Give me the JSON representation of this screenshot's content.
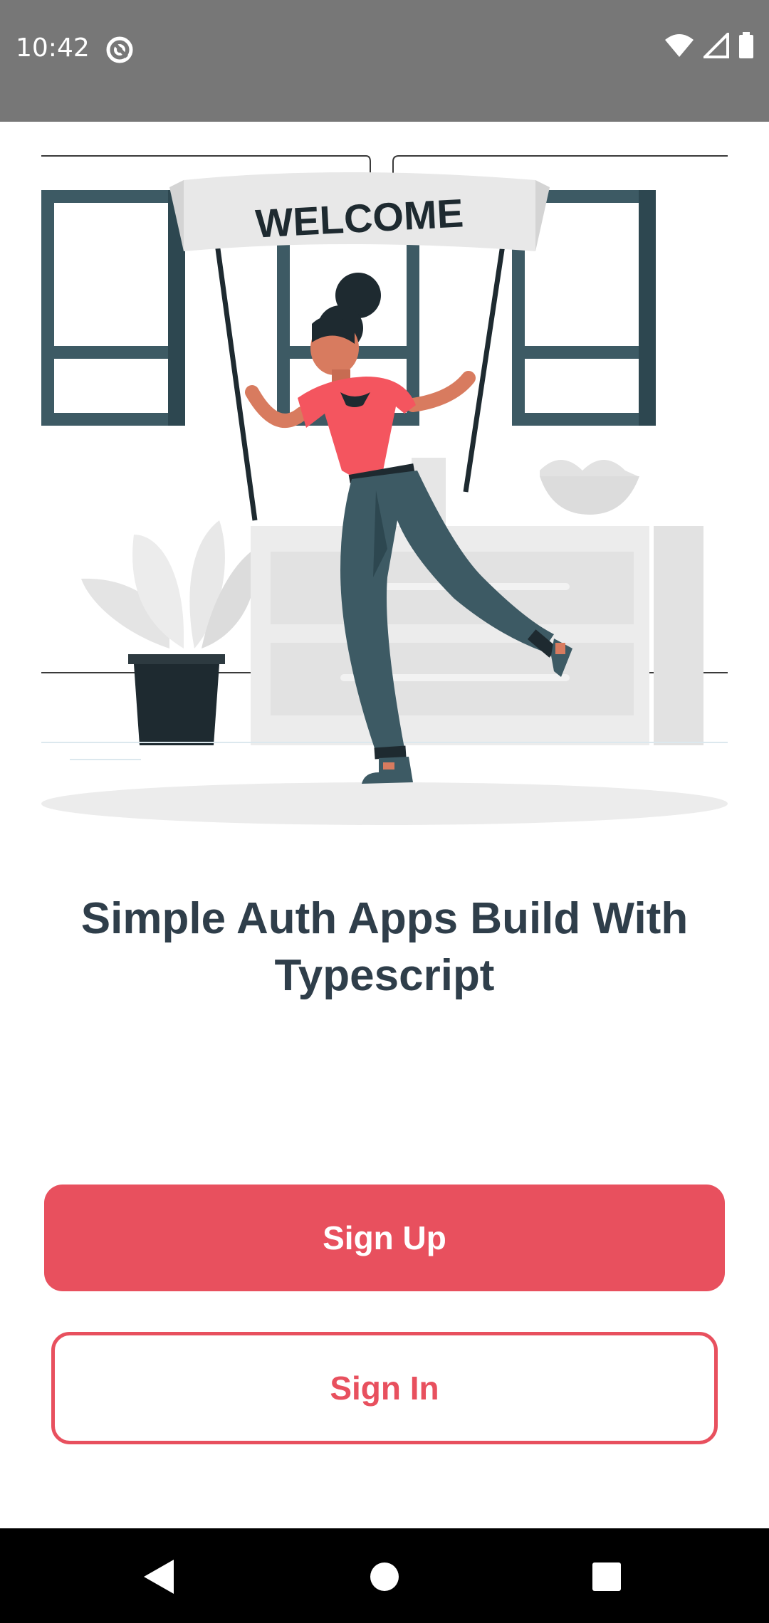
{
  "status_bar": {
    "time": "10:42",
    "app_icon": "at-sign-icon",
    "icons": [
      "wifi-icon",
      "signal-icon",
      "battery-icon"
    ]
  },
  "hero": {
    "banner_text": "WELCOME",
    "illustration": "woman-holding-welcome-banner-illustration"
  },
  "main": {
    "title": "Simple Auth Apps Build With Typescript"
  },
  "actions": {
    "signup_label": "Sign Up",
    "signin_label": "Sign In"
  },
  "colors": {
    "accent": "#e8505e",
    "title": "#2f3e4a",
    "status_bar": "#777777",
    "nav_bar": "#000000"
  },
  "nav_bar": {
    "icons": [
      "back-icon",
      "home-icon",
      "recents-icon"
    ]
  }
}
